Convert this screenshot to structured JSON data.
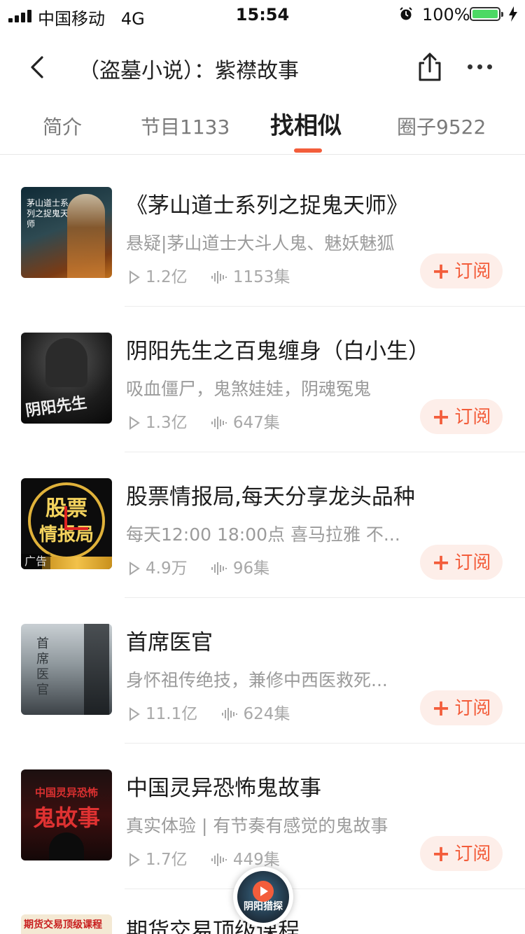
{
  "status_bar": {
    "carrier": "中国移动",
    "network": "4G",
    "time": "15:54",
    "battery": "100%",
    "battery_level": 1.0,
    "battery_color": "#4cd964"
  },
  "nav": {
    "title": "（盗墓小说）：紫襟故事",
    "back_icon": "chevron-left-icon",
    "share_icon": "share-icon",
    "more_icon": "more-dots-icon"
  },
  "tabs": [
    {
      "label": "简介",
      "active": false
    },
    {
      "label": "节目1133",
      "active": false
    },
    {
      "label": "找相似",
      "active": true
    },
    {
      "label": "圈子9522",
      "active": false
    }
  ],
  "accent_color": "#f35d3b",
  "items": [
    {
      "title": "《茅山道士系列之捉鬼天师》",
      "desc": "悬疑|茅山道士大斗人鬼、魅妖魅狐",
      "plays": "1.2亿",
      "episodes": "1153集",
      "subscribe": "订阅",
      "cover_text": "茅山道士系列之捉鬼天师"
    },
    {
      "title": "阴阳先生之百鬼缠身（白小生）",
      "desc": "吸血僵尸，鬼煞娃娃，阴魂冤鬼",
      "plays": "1.3亿",
      "episodes": "647集",
      "subscribe": "订阅",
      "cover_text": "阴阳先生"
    },
    {
      "title": "股票情报局,每天分享龙头品种",
      "desc": "每天12:00 18:00点 喜马拉雅 不...",
      "plays": "4.9万",
      "episodes": "96集",
      "subscribe": "订阅",
      "cover_text_1": "股票",
      "cover_text_2": "情报局",
      "ad_tag": "广告"
    },
    {
      "title": "首席医官",
      "desc": "身怀祖传绝技，兼修中西医救死...",
      "plays": "11.1亿",
      "episodes": "624集",
      "subscribe": "订阅",
      "cover_text": "首席医官"
    },
    {
      "title": "中国灵异恐怖鬼故事",
      "desc": "真实体验 | 有节奏有感觉的鬼故事",
      "plays": "1.7亿",
      "episodes": "449集",
      "subscribe": "订阅",
      "cover_text_1": "中国灵异恐怖",
      "cover_text_2": "鬼故事"
    }
  ],
  "partial_item": {
    "title": "期货交易顶级课程",
    "cover_text": "期货交易顶级课程"
  },
  "player": {
    "disc_text": "阴阳猎探"
  }
}
